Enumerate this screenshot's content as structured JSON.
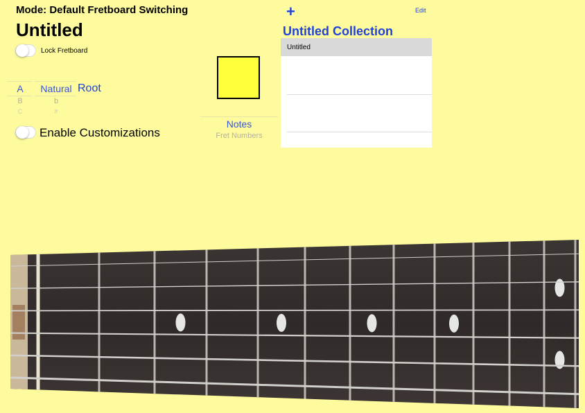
{
  "header": {
    "mode_text": "Mode: Default Fretboard Switching",
    "title": "Untitled"
  },
  "lock_fretboard": {
    "label": "Lock Fretboard",
    "on": false
  },
  "note_picker": {
    "letters": [
      "A",
      "B",
      "C"
    ],
    "selected_letter": "A",
    "accidentals": [
      "Natural",
      "b",
      "#"
    ],
    "selected_accidental": "Natural"
  },
  "root_label": "Root",
  "enable_customizations": {
    "label": "Enable Customizations",
    "on": false
  },
  "color_swatch": {
    "color": "#ffff3c"
  },
  "display_mode": {
    "options": [
      "Notes",
      "Fret Numbers"
    ],
    "selected": "Notes"
  },
  "collection": {
    "add_label": "+",
    "edit_label": "Edit",
    "title": "Untitled Collection",
    "items": [
      "Untitled"
    ]
  },
  "fretboard": {
    "board_color": "#35302e",
    "string_count": 6,
    "inlay_frets": [
      3,
      5,
      7,
      9,
      12
    ]
  }
}
